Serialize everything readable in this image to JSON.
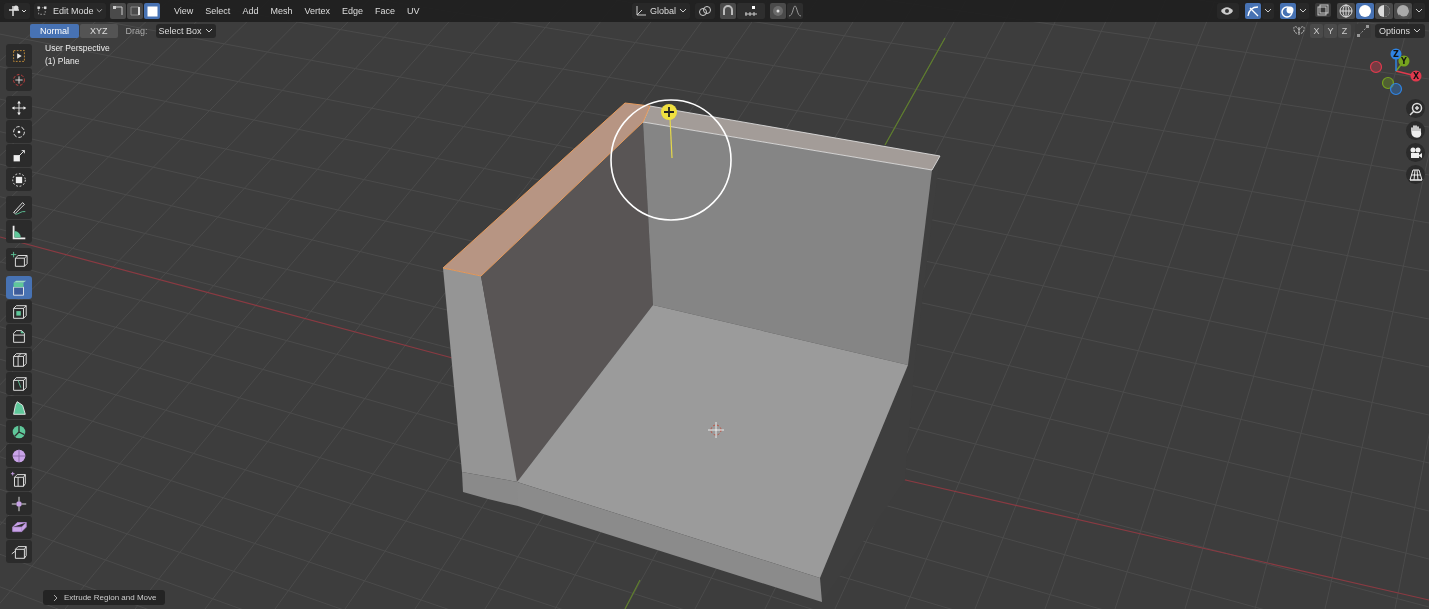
{
  "header": {
    "mode": "Edit Mode",
    "select_modes": [
      {
        "kind": "vertex",
        "selected": false
      },
      {
        "kind": "edge",
        "selected": false
      },
      {
        "kind": "face",
        "selected": true
      }
    ],
    "menus": [
      "View",
      "Select",
      "Add",
      "Mesh",
      "Vertex",
      "Edge",
      "Face",
      "UV"
    ],
    "orientation": "Global",
    "snap": {
      "on": false
    },
    "proportional": {
      "on": false
    },
    "gizmos": {
      "on": true
    },
    "overlays": {
      "on": true
    },
    "xray": {
      "on": false
    },
    "shading": [
      {
        "kind": "wireframe",
        "selected": false
      },
      {
        "kind": "solid",
        "selected": true
      },
      {
        "kind": "material",
        "selected": false
      },
      {
        "kind": "rendered",
        "selected": false
      }
    ]
  },
  "tool_settings": {
    "orientation": [
      {
        "label": "Normal",
        "selected": true
      },
      {
        "label": "XYZ",
        "selected": false
      }
    ],
    "drag_label": "Drag:",
    "drag_value": "Select Box",
    "mirror_axes": [
      {
        "label": "X",
        "on": false
      },
      {
        "label": "Y",
        "on": false
      },
      {
        "label": "Z",
        "on": false
      }
    ],
    "options": "Options"
  },
  "viewport": {
    "perspective": "User Perspective",
    "object": "(1) Plane"
  },
  "toolbar": [
    {
      "tools": [
        {
          "kind": "select",
          "selected": false
        },
        {
          "kind": "cursor",
          "selected": false
        }
      ]
    },
    {
      "tools": [
        {
          "kind": "move",
          "selected": false
        },
        {
          "kind": "rotate",
          "selected": false
        },
        {
          "kind": "scale",
          "selected": false
        },
        {
          "kind": "transform",
          "selected": false
        }
      ]
    },
    {
      "tools": [
        {
          "kind": "annotate",
          "selected": false
        },
        {
          "kind": "measure",
          "selected": false
        }
      ]
    },
    {
      "tools": [
        {
          "kind": "add-cube",
          "selected": false
        }
      ]
    },
    {
      "tools": [
        {
          "kind": "extrude",
          "selected": true
        },
        {
          "kind": "inset",
          "selected": false
        },
        {
          "kind": "bevel",
          "selected": false
        },
        {
          "kind": "loop-cut",
          "selected": false
        },
        {
          "kind": "knife",
          "selected": false
        },
        {
          "kind": "poly-build",
          "selected": false
        },
        {
          "kind": "spin",
          "selected": false
        },
        {
          "kind": "smooth",
          "selected": false
        },
        {
          "kind": "edge-slide",
          "selected": false
        },
        {
          "kind": "shrink",
          "selected": false
        },
        {
          "kind": "shear",
          "selected": false
        },
        {
          "kind": "rip",
          "selected": false
        }
      ]
    }
  ],
  "navigation_gizmo": {
    "axes": [
      {
        "label": "X",
        "color": "#e0394d"
      },
      {
        "label": "Y",
        "color": "#76a31f"
      },
      {
        "label": "Z",
        "color": "#2f84e3"
      }
    ]
  },
  "last_operator": "Extrude Region and Move"
}
